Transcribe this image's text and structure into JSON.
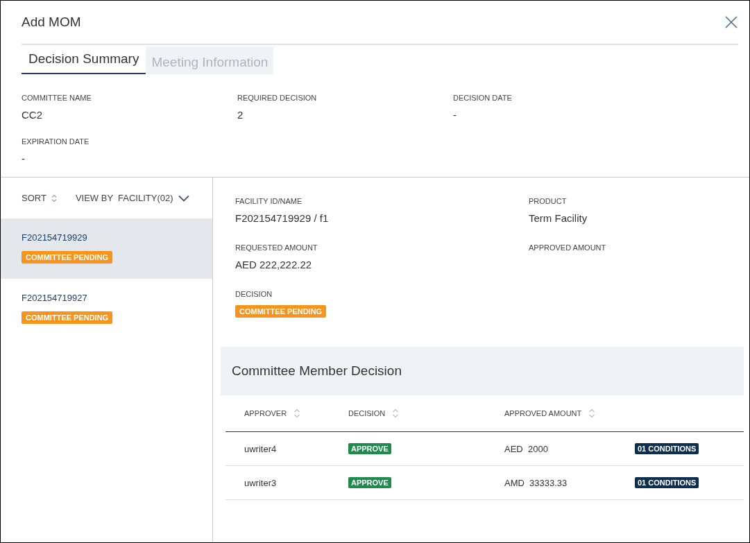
{
  "window": {
    "title": "Add MOM"
  },
  "tabs": [
    {
      "label": "Decision Summary",
      "selected": true
    },
    {
      "label": "Meeting Information",
      "selected": false
    }
  ],
  "summary": [
    {
      "label": "COMMITTEE NAME",
      "value": "CC2"
    },
    {
      "label": "REQUIRED DECISION",
      "value": "2"
    },
    {
      "label": "DECISION DATE",
      "value": "-"
    },
    {
      "label": "EXPIRATION DATE",
      "value": "-"
    }
  ],
  "list_toolbar": {
    "sort": "SORT",
    "view_by": "VIEW BY",
    "view_value": "FACILITY(02)"
  },
  "facilities": [
    {
      "id": "F202154719929",
      "status": {
        "text": "COMMITTEE PENDING",
        "kind": "pending"
      },
      "selected": true
    },
    {
      "id": "F202154719927",
      "status": {
        "text": "COMMITTEE PENDING",
        "kind": "pending"
      },
      "selected": false
    }
  ],
  "details": [
    {
      "label": "FACILITY ID/NAME",
      "value": "F202154719929 / f1"
    },
    {
      "label": "PRODUCT",
      "value": "Term Facility"
    },
    {
      "label": "REQUESTED AMOUNT",
      "value": "AED 222,222.22"
    },
    {
      "label": "APPROVED AMOUNT"
    },
    {
      "label": "DECISION",
      "badge": {
        "text": "COMMITTEE PENDING",
        "kind": "pending"
      }
    }
  ],
  "member_decision": {
    "title": "Committee Member Decision",
    "columns": [
      "APPROVER",
      "DECISION",
      "APPROVED AMOUNT"
    ],
    "rows": [
      {
        "approver": "uwriter4",
        "decision": {
          "text": "APPROVE",
          "kind": "approve"
        },
        "currency": "AED",
        "amount": "2000",
        "conditions": {
          "text": "01 CONDITIONS",
          "kind": "conditions"
        }
      },
      {
        "approver": "uwriter3",
        "decision": {
          "text": "APPROVE",
          "kind": "approve"
        },
        "currency": "AMD",
        "amount": "33333.33",
        "conditions": {
          "text": "01 CONDITIONS",
          "kind": "conditions"
        }
      }
    ]
  }
}
